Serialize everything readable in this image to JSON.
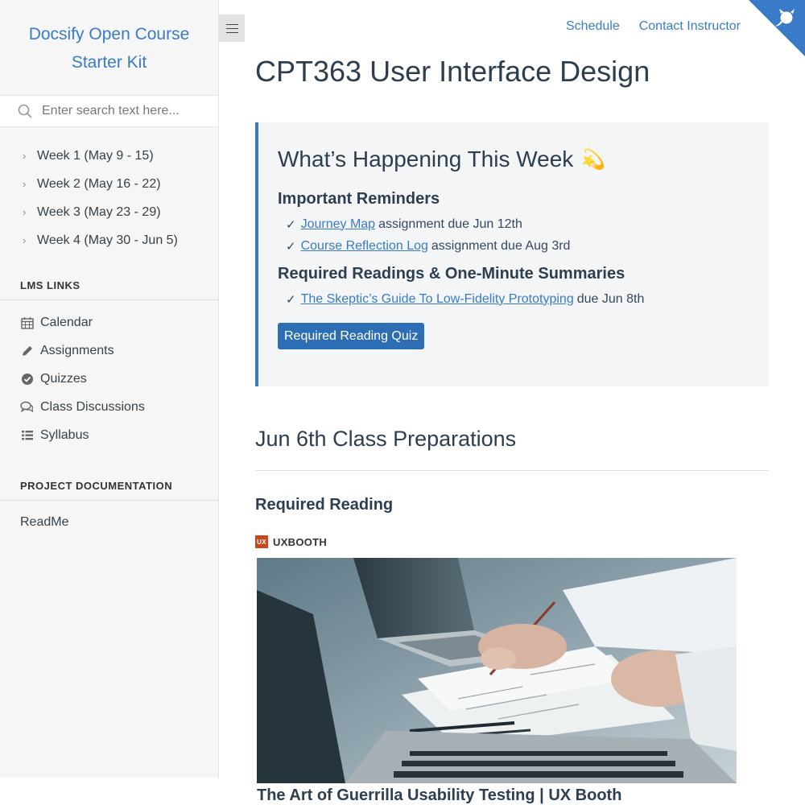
{
  "sidebar": {
    "app_name_line1": "Docsify Open Course",
    "app_name_line2": "Starter Kit",
    "search_placeholder": "Enter search text here...",
    "weeks": [
      {
        "label": "Week 1 (May 9 - 15)"
      },
      {
        "label": "Week 2 (May 16 - 22)"
      },
      {
        "label": "Week 3 (May 23 - 29)"
      },
      {
        "label": "Week 4 (May 30 - Jun 5)"
      }
    ],
    "lms_title": "LMS LINKS",
    "lms_links": [
      {
        "label": "Calendar",
        "icon": "calendar-icon"
      },
      {
        "label": "Assignments",
        "icon": "pencil-icon"
      },
      {
        "label": "Quizzes",
        "icon": "check-circle-icon"
      },
      {
        "label": "Class Discussions",
        "icon": "comments-icon"
      },
      {
        "label": "Syllabus",
        "icon": "list-icon"
      }
    ],
    "project_title": "PROJECT DOCUMENTATION",
    "readme": "ReadMe"
  },
  "nav": {
    "schedule": "Schedule",
    "contact": "Contact Instructor"
  },
  "main": {
    "title": "CPT363 User Interface Design",
    "week_box": {
      "heading": "What’s Happening This Week",
      "heading_icon": "💫",
      "reminders_title": "Important Reminders",
      "reminders": [
        {
          "link": "Journey Map",
          "text": "assignment due Jun 12th"
        },
        {
          "link": "Course Reflection Log",
          "text": "assignment due Aug 3rd"
        }
      ],
      "readings_title": "Required Readings & One-Minute Summaries",
      "readings": [
        {
          "link": "The Skeptic’s Guide To Low-Fidelity Prototyping",
          "text": "due Jun 8th"
        }
      ],
      "quiz_button": "Required Reading Quiz"
    },
    "section_title": "Jun 6th Class Preparations",
    "required_reading_title": "Required Reading",
    "article": {
      "source_logo": "UX",
      "source": "UXBOOTH",
      "title": "The Art of Guerrilla Usability Testing | UX Booth"
    }
  },
  "colors": {
    "accent": "#3a7bc8",
    "button": "#2d6db3",
    "callout_bg": "#f3f5f7"
  }
}
